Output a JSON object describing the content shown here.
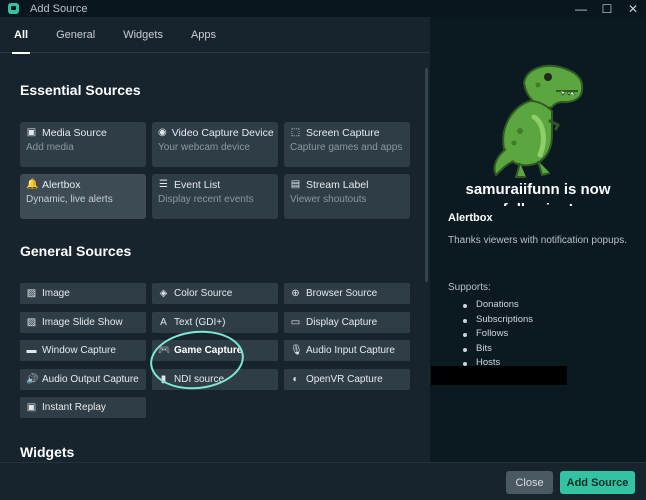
{
  "window": {
    "title": "Add Source",
    "minimize": "—",
    "maximize": "☐",
    "close": "✕"
  },
  "tabs": [
    {
      "label": "All",
      "active": true
    },
    {
      "label": "General",
      "active": false
    },
    {
      "label": "Widgets",
      "active": false
    },
    {
      "label": "Apps",
      "active": false
    }
  ],
  "essential": {
    "title": "Essential Sources",
    "cards": [
      {
        "icon": "film-icon",
        "glyph": "▣",
        "title": "Media Source",
        "desc": "Add media"
      },
      {
        "icon": "webcam-icon",
        "glyph": "◉",
        "title": "Video Capture Device",
        "desc": "Your webcam device"
      },
      {
        "icon": "screen-capture-icon",
        "glyph": "⬚",
        "title": "Screen Capture",
        "desc": "Capture games and apps"
      },
      {
        "icon": "bell-icon",
        "glyph": "🔔",
        "title": "Alertbox",
        "desc": "Dynamic, live alerts"
      },
      {
        "icon": "list-icon",
        "glyph": "☰",
        "title": "Event List",
        "desc": "Display recent events"
      },
      {
        "icon": "label-icon",
        "glyph": "▤",
        "title": "Stream Label",
        "desc": "Viewer shoutouts"
      }
    ]
  },
  "general": {
    "title": "General Sources",
    "items": [
      {
        "icon": "image-icon",
        "glyph": "▨",
        "title": "Image"
      },
      {
        "icon": "color-icon",
        "glyph": "◈",
        "title": "Color Source"
      },
      {
        "icon": "globe-icon",
        "glyph": "⊕",
        "title": "Browser Source"
      },
      {
        "icon": "slideshow-icon",
        "glyph": "▨",
        "title": "Image Slide Show"
      },
      {
        "icon": "text-icon",
        "glyph": "A",
        "title": "Text (GDI+)"
      },
      {
        "icon": "monitor-icon",
        "glyph": "▭",
        "title": "Display Capture"
      },
      {
        "icon": "window-icon",
        "glyph": "▬",
        "title": "Window Capture"
      },
      {
        "icon": "gamepad-icon",
        "glyph": "🎮",
        "title": "Game Capture"
      },
      {
        "icon": "microphone-icon",
        "glyph": "🎙",
        "title": "Audio Input Capture"
      },
      {
        "icon": "speaker-icon",
        "glyph": "🔊",
        "title": "Audio Output Capture"
      },
      {
        "icon": "ndi-icon",
        "glyph": "▮",
        "title": "NDI source"
      },
      {
        "icon": "vr-icon",
        "glyph": "◐",
        "title": "OpenVR Capture"
      },
      {
        "icon": "replay-icon",
        "glyph": "▣",
        "title": "Instant Replay"
      }
    ]
  },
  "widgets": {
    "title": "Widgets"
  },
  "preview": {
    "notice": "samuraiifunn is now following!",
    "title": "Alertbox",
    "description": "Thanks viewers with notification popups.",
    "supports_label": "Supports:",
    "supports": [
      "Donations",
      "Subscriptions",
      "Follows",
      "Bits",
      "Hosts"
    ]
  },
  "footer": {
    "close_label": "Close",
    "add_label": "Add Source"
  },
  "colors": {
    "accent": "#31c3a2",
    "background": "#17242d",
    "card": "#2e3d46",
    "panel": "#0b1a21"
  }
}
